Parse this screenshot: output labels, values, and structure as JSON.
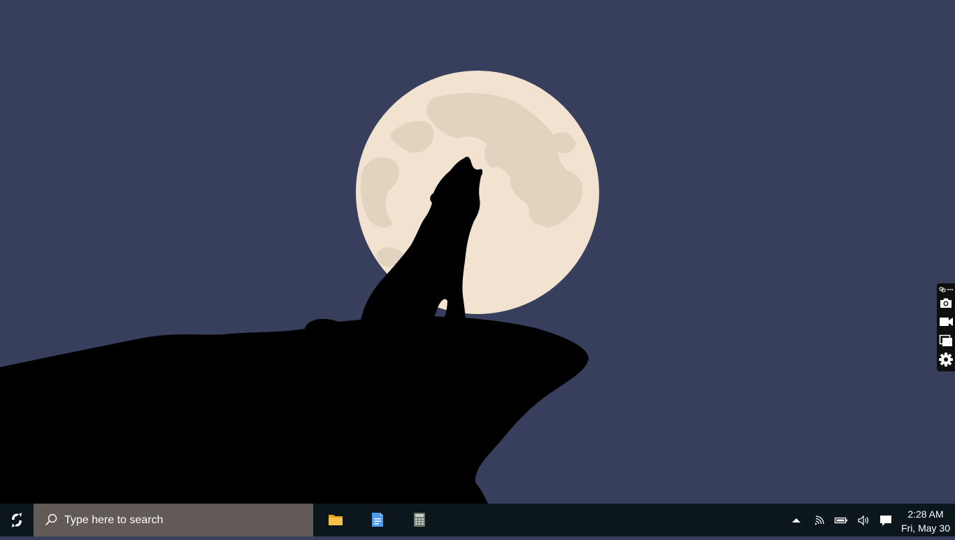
{
  "colors": {
    "sky": "#383f5c",
    "moon": "#f2e3d1",
    "moon_spots": "#e2d3bf",
    "silhouette": "#000000",
    "taskbar": "#0c161d",
    "search_box": "#615a57",
    "folder_icon": "#f6c14a",
    "notepad_icon": "#4c9bf0",
    "calculator_icon": "#9aa39a"
  },
  "desktop": {
    "wallpaper": "wolf-howling-at-full-moon"
  },
  "capture_toolbar": {
    "buttons": [
      "camera-icon",
      "video-camera-icon",
      "window-capture-icon",
      "gear-icon"
    ]
  },
  "taskbar": {
    "search": {
      "placeholder": "Type here to search"
    },
    "pinned_apps": [
      "file-explorer-icon",
      "notepad-icon",
      "calculator-icon"
    ],
    "tray_icons": [
      "chevron-up-icon",
      "network-icon",
      "battery-icon",
      "volume-icon",
      "notification-icon"
    ],
    "clock": {
      "time": "2:28 AM",
      "date": "Fri, May 30"
    }
  }
}
